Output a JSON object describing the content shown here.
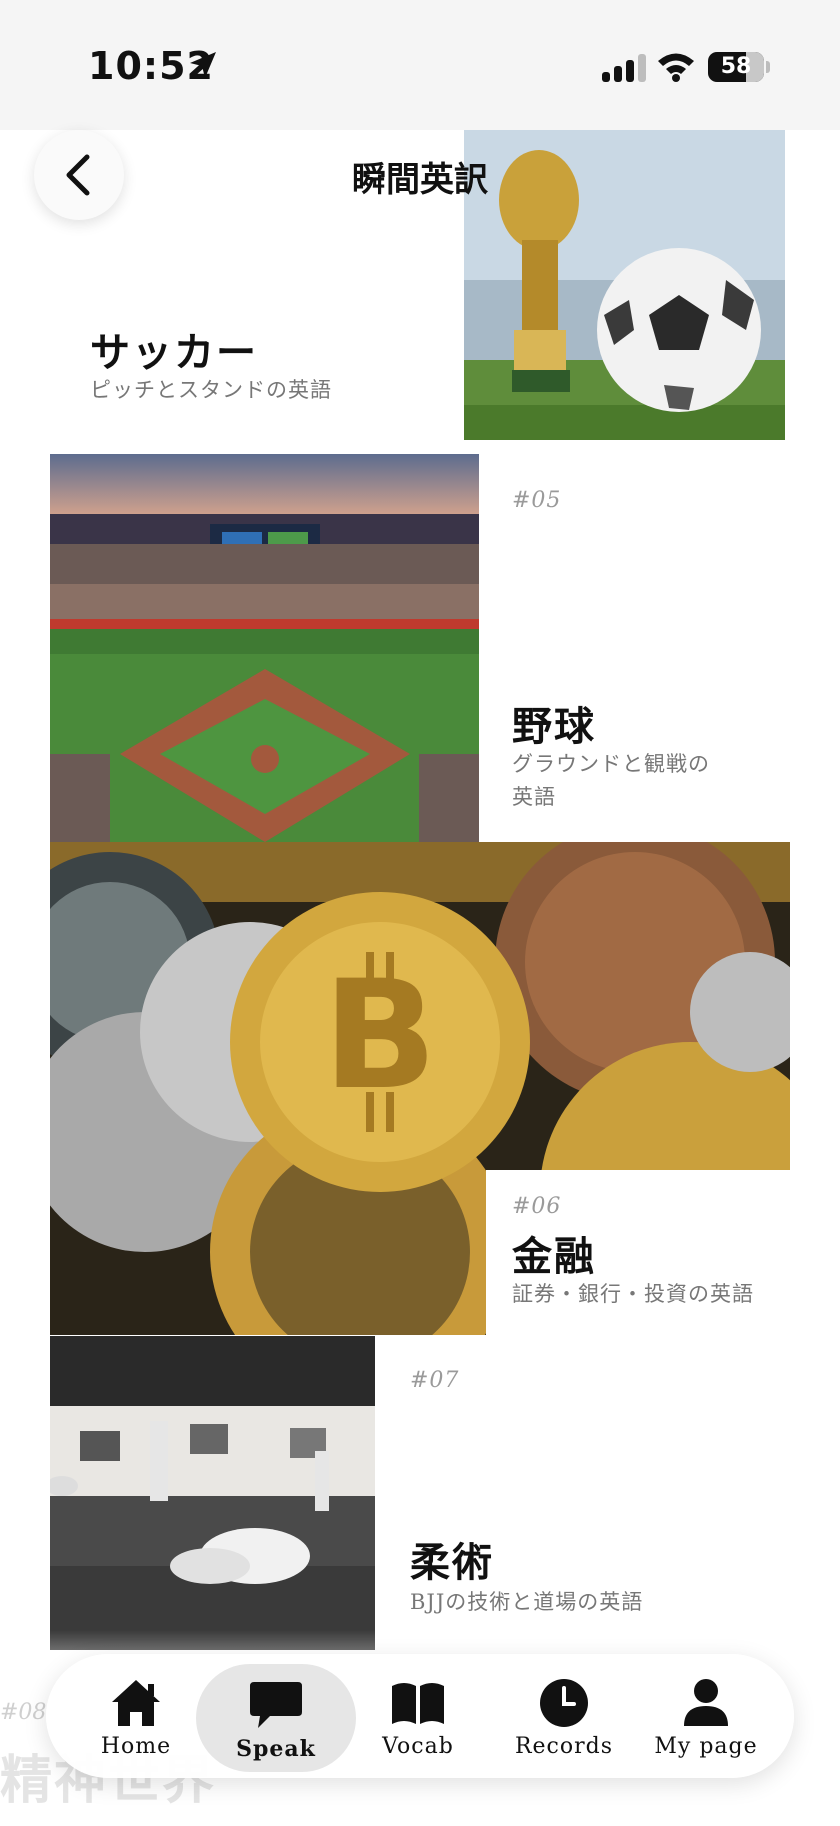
{
  "status": {
    "time": "10:52",
    "battery": "58"
  },
  "header": {
    "title": "瞬間英訳",
    "back_icon": "chevron-left-icon"
  },
  "cards": [
    {
      "id": "soccer",
      "number": "",
      "title": "サッカー",
      "subtitle": "ピッチとスタンドの英語"
    },
    {
      "id": "baseball",
      "number": "#05",
      "title": "野球",
      "subtitle_line1": "グラウンドと観戦の",
      "subtitle_line2": "英語"
    },
    {
      "id": "finance",
      "number": "#06",
      "title": "金融",
      "subtitle": "証券・銀行・投資の英語"
    },
    {
      "id": "jiujitsu",
      "number": "#07",
      "title": "柔術",
      "subtitle": "BJJの技術と道場の英語"
    },
    {
      "id": "next",
      "number": "#08",
      "title": "精神世界"
    }
  ],
  "tabs": [
    {
      "label": "Home",
      "icon": "home-icon",
      "active": false
    },
    {
      "label": "Speak",
      "icon": "chat-bubble-icon",
      "active": true
    },
    {
      "label": "Vocab",
      "icon": "book-icon",
      "active": false
    },
    {
      "label": "Records",
      "icon": "clock-icon",
      "active": false
    },
    {
      "label": "My page",
      "icon": "person-icon",
      "active": false
    }
  ],
  "colors": {
    "accent": "#111111",
    "active_tab_bg": "#e6e6e6",
    "muted_text": "#777777"
  }
}
